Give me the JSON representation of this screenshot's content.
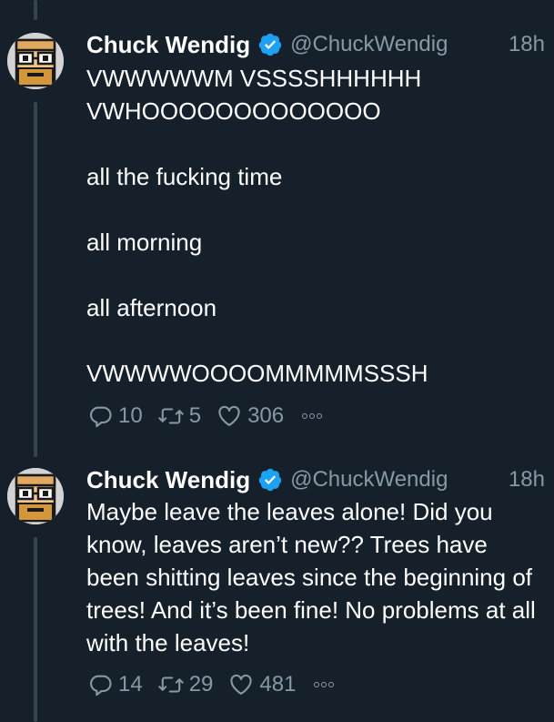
{
  "tweets": [
    {
      "author_name": "Chuck Wendig",
      "author_handle": "@ChuckWendig",
      "time": "18h",
      "paragraphs": [
        "VWWWWWM VSSSSHHHHHH",
        "VWHOOOOOOOOOOOOO",
        "all the fucking time",
        "all morning",
        "all afternoon",
        "VWWWWOOOOMMMMMSSSH"
      ],
      "replies": "10",
      "retweets": "5",
      "likes": "306"
    },
    {
      "author_name": "Chuck Wendig",
      "author_handle": "@ChuckWendig",
      "time": "18h",
      "paragraphs": [
        "Maybe leave the leaves alone! Did you know, leaves aren’t new?? Trees have been shitting leaves since the beginning of trees! And it’s been fine! No problems at all with the leaves!"
      ],
      "replies": "14",
      "retweets": "29",
      "likes": "481"
    }
  ],
  "icons": {
    "verified": "verified-badge-icon",
    "reply": "reply-icon",
    "retweet": "retweet-icon",
    "like": "heart-icon",
    "more": "more-icon"
  },
  "colors": {
    "background": "#15202b",
    "text": "#ffffff",
    "secondary": "#8899a6",
    "verified": "#1da1f2",
    "thread_line": "#38444d"
  }
}
